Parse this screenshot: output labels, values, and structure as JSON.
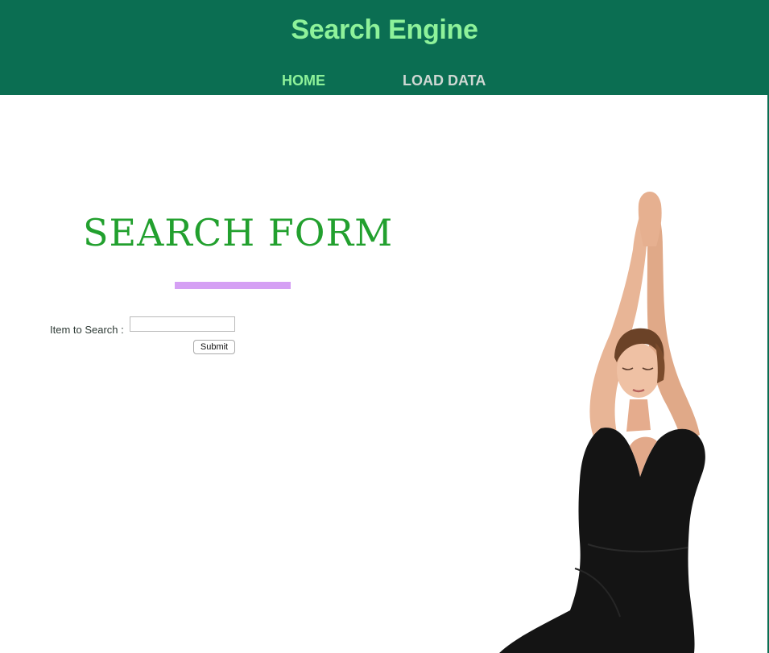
{
  "header": {
    "title": "Search Engine",
    "nav": [
      {
        "label": "HOME"
      },
      {
        "label": "LOAD DATA"
      }
    ]
  },
  "main": {
    "heading": "SEARCH FORM",
    "form": {
      "label": "Item to Search :",
      "input_value": "",
      "submit_label": "Submit"
    }
  },
  "colors": {
    "header_bg": "#0b6e52",
    "title": "#8ef29a",
    "nav_active": "#8ef29a",
    "nav_inactive": "#cfd8d3",
    "heading": "#22a02e",
    "accent_bar": "#d5a0f4"
  },
  "image": {
    "subject": "yoga-woman-photo"
  }
}
